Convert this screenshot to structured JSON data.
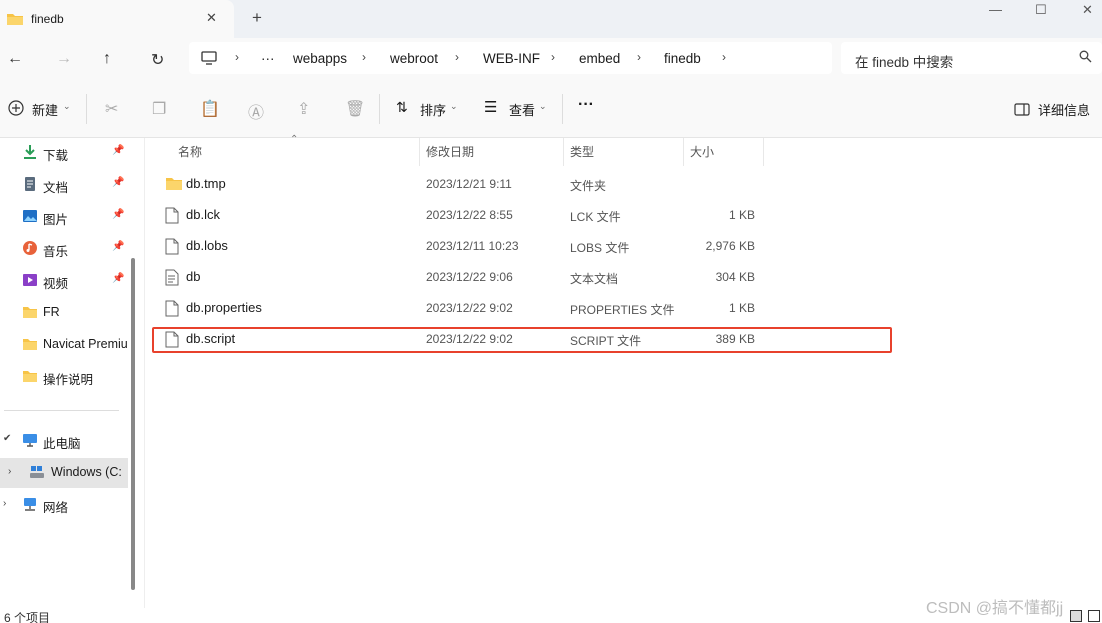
{
  "tab": {
    "title": "finedb",
    "close": "✕",
    "new": "+"
  },
  "window": {
    "minimize": "—",
    "maximize": "☐",
    "close": "✕"
  },
  "nav": {
    "back": "←",
    "forward": "→",
    "up": "↑",
    "refresh": "↻"
  },
  "address": {
    "more": "···",
    "sep": "›",
    "crumbs": [
      "webapps",
      "webroot",
      "WEB-INF",
      "embed",
      "finedb"
    ]
  },
  "search": {
    "placeholder": "在 finedb 中搜索"
  },
  "toolbar": {
    "new_label": "新建",
    "sort_label": "排序",
    "view_label": "查看",
    "more": "···",
    "details_label": "详细信息"
  },
  "sidebar": {
    "quick_access": [
      {
        "label": "下载",
        "icon": "download-icon"
      },
      {
        "label": "文档",
        "icon": "document-icon"
      },
      {
        "label": "图片",
        "icon": "pictures-icon"
      },
      {
        "label": "音乐",
        "icon": "music-icon"
      },
      {
        "label": "视频",
        "icon": "video-icon"
      },
      {
        "label": "FR",
        "icon": "folder-icon"
      },
      {
        "label": "Navicat Premiu",
        "icon": "folder-icon"
      },
      {
        "label": "操作说明",
        "icon": "folder-icon"
      }
    ],
    "this_pc": "此电脑",
    "drive": "Windows  (C:",
    "network": "网络"
  },
  "columns": {
    "name": "名称",
    "date": "修改日期",
    "type": "类型",
    "size": "大小"
  },
  "files": [
    {
      "name": "db.tmp",
      "date": "2023/12/21 9:11",
      "type": "文件夹",
      "size": "",
      "icon": "folder-icon"
    },
    {
      "name": "db.lck",
      "date": "2023/12/22 8:55",
      "type": "LCK 文件",
      "size": "1 KB",
      "icon": "file-icon"
    },
    {
      "name": "db.lobs",
      "date": "2023/12/11 10:23",
      "type": "LOBS 文件",
      "size": "2,976 KB",
      "icon": "file-icon"
    },
    {
      "name": "db",
      "date": "2023/12/22 9:06",
      "type": "文本文档",
      "size": "304 KB",
      "icon": "text-file-icon"
    },
    {
      "name": "db.properties",
      "date": "2023/12/22 9:02",
      "type": "PROPERTIES 文件",
      "size": "1 KB",
      "icon": "file-icon"
    },
    {
      "name": "db.script",
      "date": "2023/12/22 9:02",
      "type": "SCRIPT 文件",
      "size": "389 KB",
      "icon": "file-icon"
    }
  ],
  "status": {
    "count": "6 个项目"
  },
  "watermark": "CSDN @搞不懂都jj",
  "colors": {
    "highlight": "#e8412c",
    "folder": "#f7c447",
    "accent": "#0067c0"
  }
}
